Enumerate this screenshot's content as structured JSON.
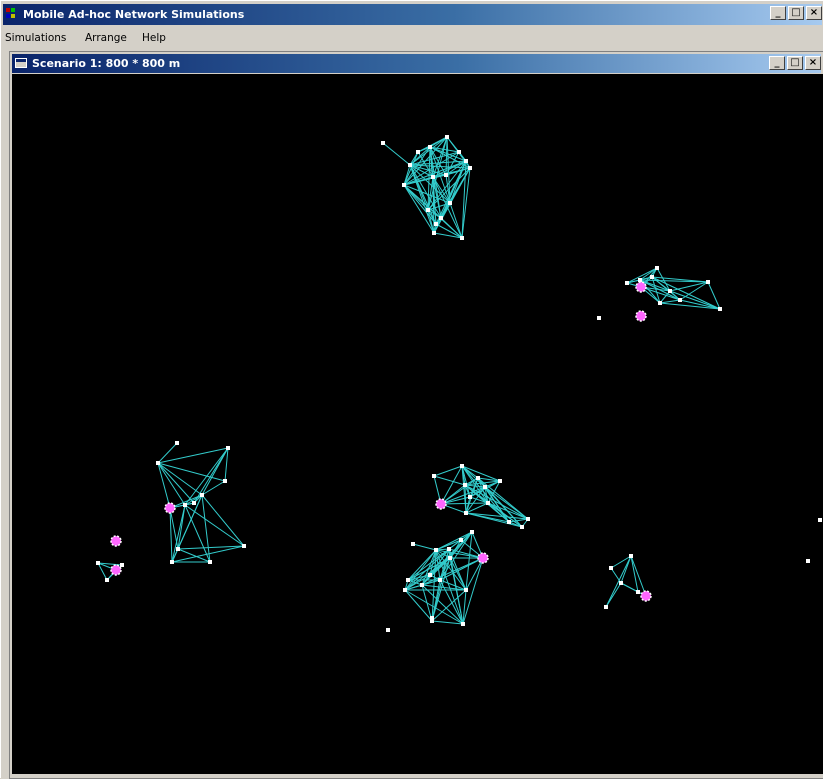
{
  "app": {
    "title": "Mobile Ad-hoc Network Simulations",
    "controls": {
      "minimize": "_",
      "restore": "□",
      "close": "×"
    }
  },
  "menu": [
    "Simulations",
    "Arrange",
    "Help"
  ],
  "child": {
    "title": "Scenario 1: 800 * 800 m",
    "controls": {
      "minimize": "_",
      "restore": "□",
      "close": "×"
    }
  },
  "colors": {
    "link": "#33cccc",
    "node": "#ffffff",
    "special_node": "#ff66ff",
    "canvas": "#000000",
    "title_start": "#0a246a",
    "title_end": "#a6caf0"
  }
}
